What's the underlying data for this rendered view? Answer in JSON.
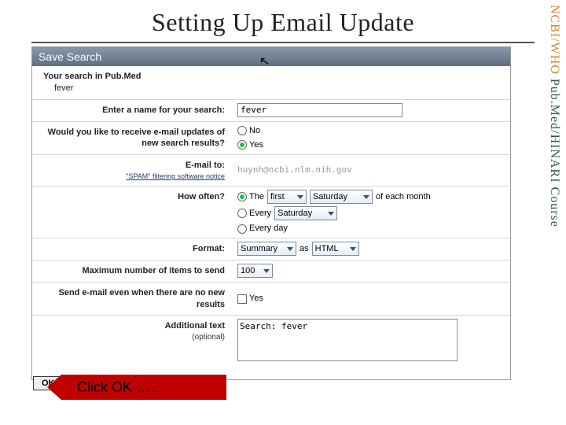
{
  "slide": {
    "title": "Setting Up Email Update"
  },
  "sidebar": {
    "line1": "NCBI/WHO",
    "line2": " Pub.Med/HINARI Course"
  },
  "panel": {
    "header": "Save Search",
    "search_label": "Your search in Pub.Med",
    "search_value": "fever",
    "name_label": "Enter a name for your search:",
    "name_value": "fever",
    "updates_label": "Would you like to receive e-mail updates of new search results?",
    "opt_no": "No",
    "opt_yes": "Yes",
    "emailto_label": "E-mail to:",
    "emailto_sub": "\"SPAM\" filtering software notice",
    "emailto_value": "huynh@ncbi.nlm.nih.gov",
    "howoften_label": "How often?",
    "ho_the": "The",
    "ho_first": "first",
    "ho_saturday": "Saturday",
    "ho_ofeach": "of each month",
    "ho_every": "Every",
    "ho_every_val": "Saturday",
    "ho_everyday": "Every day",
    "format_label": "Format:",
    "format_val": "Summary",
    "format_as": "as",
    "format_html": "HTML",
    "max_label": "Maximum number of items to send",
    "max_val": "100",
    "even_label": "Send e-mail even when there are no new results",
    "even_yes": "Yes",
    "addl_label": "Additional text",
    "addl_sub": "(optional)",
    "addl_value": "Search: fever",
    "ok": "OK"
  },
  "callout": {
    "text": "Click OK ….."
  }
}
